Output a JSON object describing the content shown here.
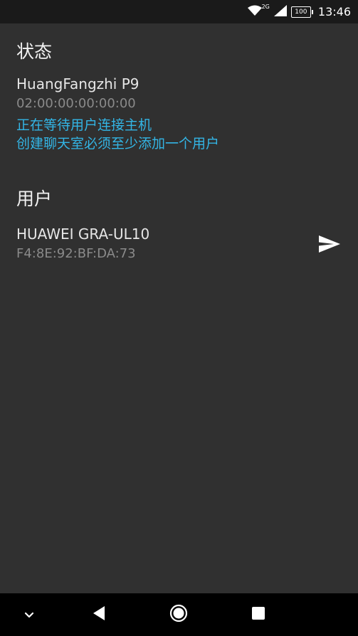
{
  "status_bar": {
    "time": "13:46",
    "battery_level": "100",
    "network_type": "2G",
    "icons": [
      "wifi-icon",
      "signal-icon",
      "battery-icon"
    ]
  },
  "status_section": {
    "title": "状态",
    "device_name": "HuangFangzhi P9",
    "device_mac": "02:00:00:00:00:00",
    "messages": [
      "正在等待用户连接主机",
      "创建聊天室必须至少添加一个用户"
    ]
  },
  "users_section": {
    "title": "用户",
    "users": [
      {
        "name": "HUAWEI GRA-UL10",
        "mac": "F4:8E:92:BF:DA:73",
        "action_icon": "send-icon"
      }
    ]
  },
  "nav_bar": {
    "buttons": [
      "collapse-icon",
      "back-icon",
      "home-icon",
      "recents-icon"
    ]
  },
  "colors": {
    "background": "#303030",
    "status_bar": "#1a1a1a",
    "accent": "#33b5e5",
    "secondary_text": "#8a8a8a",
    "nav_bar": "#000000"
  }
}
